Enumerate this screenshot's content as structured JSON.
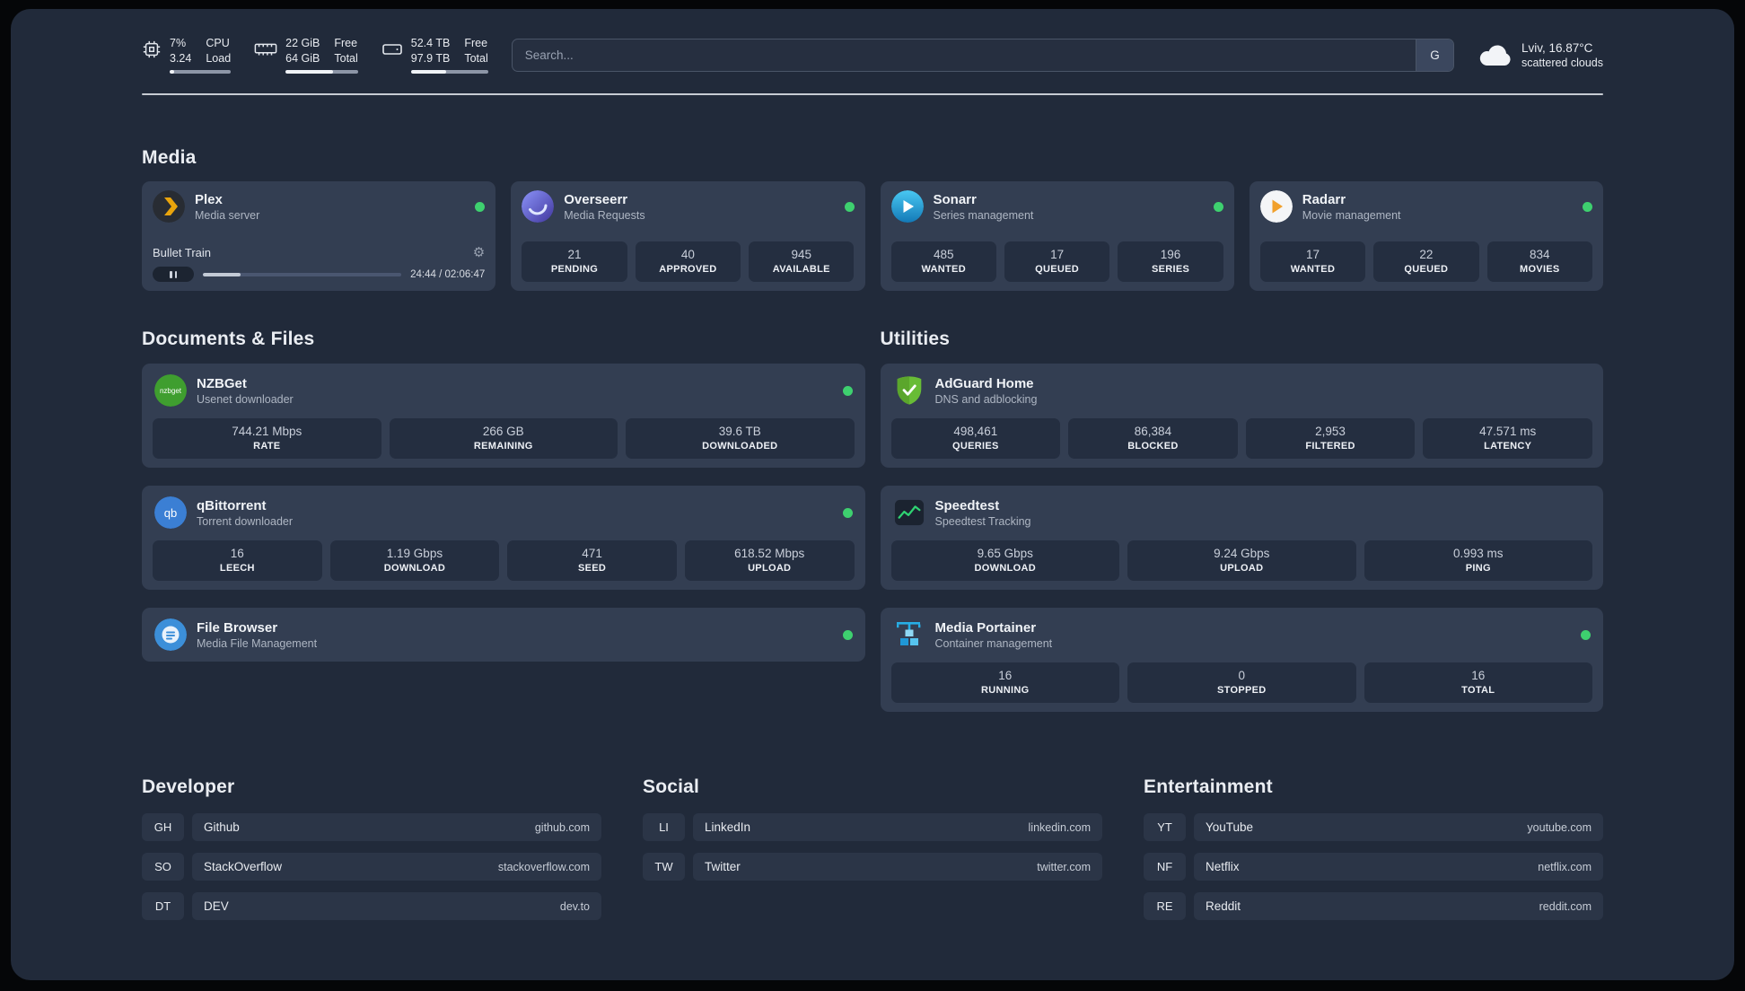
{
  "colors": {
    "background": "#212a3a",
    "card": "#333e52",
    "stat_tile": "#242e40",
    "online_dot": "#3ed06f",
    "speedtest_accent": "#2fd272",
    "plex_accent": "#e9a40c"
  },
  "topbar": {
    "cpu": {
      "value": "7%",
      "sub": "3.24",
      "label_top": "CPU",
      "label_bottom": "Load",
      "fill": "7%"
    },
    "memory": {
      "value": "22 GiB",
      "sub": "64 GiB",
      "label_top": "Free",
      "label_bottom": "Total",
      "fill": "66%"
    },
    "disk": {
      "value": "52.4 TB",
      "sub": "97.9 TB",
      "label_top": "Free",
      "label_bottom": "Total",
      "fill": "46%"
    },
    "search": {
      "placeholder": "Search...",
      "provider_label": "G"
    },
    "weather": {
      "location": "Lviv, 16.87°C",
      "condition": "scattered clouds"
    }
  },
  "sections": {
    "media": {
      "title": "Media",
      "services": [
        {
          "name": "Plex",
          "subtitle": "Media server",
          "status": "online",
          "now_playing": {
            "title": "Bullet Train",
            "time": "24:44 / 02:06:47",
            "progress": "19%"
          }
        },
        {
          "name": "Overseerr",
          "subtitle": "Media Requests",
          "status": "online",
          "stats": [
            {
              "value": "21",
              "label": "PENDING"
            },
            {
              "value": "40",
              "label": "APPROVED"
            },
            {
              "value": "945",
              "label": "AVAILABLE"
            }
          ]
        },
        {
          "name": "Sonarr",
          "subtitle": "Series management",
          "status": "online",
          "stats": [
            {
              "value": "485",
              "label": "WANTED"
            },
            {
              "value": "17",
              "label": "QUEUED"
            },
            {
              "value": "196",
              "label": "SERIES"
            }
          ]
        },
        {
          "name": "Radarr",
          "subtitle": "Movie management",
          "status": "online",
          "stats": [
            {
              "value": "17",
              "label": "WANTED"
            },
            {
              "value": "22",
              "label": "QUEUED"
            },
            {
              "value": "834",
              "label": "MOVIES"
            }
          ]
        }
      ]
    },
    "documents": {
      "title": "Documents & Files",
      "services": [
        {
          "name": "NZBGet",
          "subtitle": "Usenet downloader",
          "status": "online",
          "stats": [
            {
              "value": "744.21 Mbps",
              "label": "RATE"
            },
            {
              "value": "266 GB",
              "label": "REMAINING"
            },
            {
              "value": "39.6 TB",
              "label": "DOWNLOADED"
            }
          ]
        },
        {
          "name": "qBittorrent",
          "subtitle": "Torrent downloader",
          "status": "online",
          "stats": [
            {
              "value": "16",
              "label": "LEECH"
            },
            {
              "value": "1.19 Gbps",
              "label": "DOWNLOAD"
            },
            {
              "value": "471",
              "label": "SEED"
            },
            {
              "value": "618.52 Mbps",
              "label": "UPLOAD"
            }
          ]
        },
        {
          "name": "File Browser",
          "subtitle": "Media File Management",
          "status": "online"
        }
      ]
    },
    "utilities": {
      "title": "Utilities",
      "services": [
        {
          "name": "AdGuard Home",
          "subtitle": "DNS and adblocking",
          "stats": [
            {
              "value": "498,461",
              "label": "QUERIES"
            },
            {
              "value": "86,384",
              "label": "BLOCKED"
            },
            {
              "value": "2,953",
              "label": "FILTERED"
            },
            {
              "value": "47.571 ms",
              "label": "LATENCY"
            }
          ]
        },
        {
          "name": "Speedtest",
          "subtitle": "Speedtest Tracking",
          "stats": [
            {
              "value": "9.65 Gbps",
              "label": "DOWNLOAD"
            },
            {
              "value": "9.24 Gbps",
              "label": "UPLOAD"
            },
            {
              "value": "0.993 ms",
              "label": "PING"
            }
          ]
        },
        {
          "name": "Media Portainer",
          "subtitle": "Container management",
          "status": "online",
          "stats": [
            {
              "value": "16",
              "label": "RUNNING"
            },
            {
              "value": "0",
              "label": "STOPPED"
            },
            {
              "value": "16",
              "label": "TOTAL"
            }
          ]
        }
      ]
    },
    "bookmarks": [
      {
        "title": "Developer",
        "links": [
          {
            "abbr": "GH",
            "name": "Github",
            "url": "github.com"
          },
          {
            "abbr": "SO",
            "name": "StackOverflow",
            "url": "stackoverflow.com"
          },
          {
            "abbr": "DT",
            "name": "DEV",
            "url": "dev.to"
          }
        ]
      },
      {
        "title": "Social",
        "links": [
          {
            "abbr": "LI",
            "name": "LinkedIn",
            "url": "linkedin.com"
          },
          {
            "abbr": "TW",
            "name": "Twitter",
            "url": "twitter.com"
          }
        ]
      },
      {
        "title": "Entertainment",
        "links": [
          {
            "abbr": "YT",
            "name": "YouTube",
            "url": "youtube.com"
          },
          {
            "abbr": "NF",
            "name": "Netflix",
            "url": "netflix.com"
          },
          {
            "abbr": "RE",
            "name": "Reddit",
            "url": "reddit.com"
          }
        ]
      }
    ]
  }
}
